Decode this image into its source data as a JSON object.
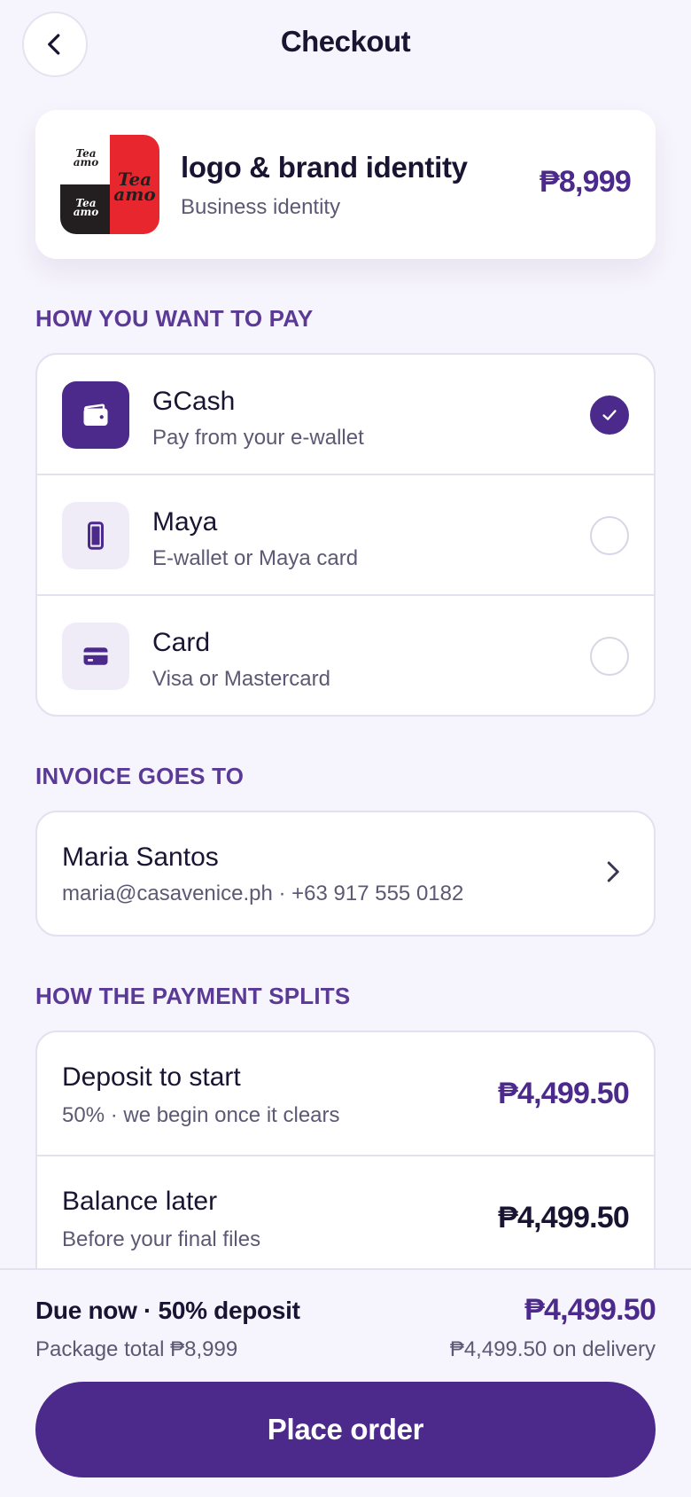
{
  "header": {
    "title": "Checkout",
    "back_icon": "chevron-left-icon"
  },
  "product": {
    "name": "logo & brand identity",
    "category": "Business identity",
    "price": "₱8,999",
    "thumbnail_text": "Tea amo",
    "colors": {
      "red": "#e8262e",
      "black": "#231f20",
      "white": "#ffffff"
    }
  },
  "payment": {
    "section_label": "HOW YOU WANT TO PAY",
    "options": [
      {
        "title": "GCash",
        "subtitle": "Pay from your e-wallet",
        "icon": "wallet-icon",
        "selected": true
      },
      {
        "title": "Maya",
        "subtitle": "E-wallet or Maya card",
        "icon": "phone-icon",
        "selected": false
      },
      {
        "title": "Card",
        "subtitle": "Visa or Mastercard",
        "icon": "credit-card-icon",
        "selected": false
      }
    ]
  },
  "invoice": {
    "section_label": "INVOICE GOES TO",
    "name": "Maria Santos",
    "contact": "maria@casavenice.ph · +63 917 555 0182"
  },
  "split": {
    "section_label": "HOW THE PAYMENT SPLITS",
    "rows": [
      {
        "title": "Deposit to start",
        "subtitle": "50% · we begin once it clears",
        "amount": "₱4,499.50"
      },
      {
        "title": "Balance later",
        "subtitle": "Before your final files",
        "amount": "₱4,499.50"
      }
    ]
  },
  "footer": {
    "due_label": "Due now · 50% deposit",
    "due_amount": "₱4,499.50",
    "package_total": "Package total ₱8,999",
    "delivery_note": "₱4,499.50 on delivery",
    "cta_label": "Place order"
  },
  "colors": {
    "accent": "#4b2a8c",
    "section_label": "#5a3a96",
    "background": "#f6f4fc"
  }
}
